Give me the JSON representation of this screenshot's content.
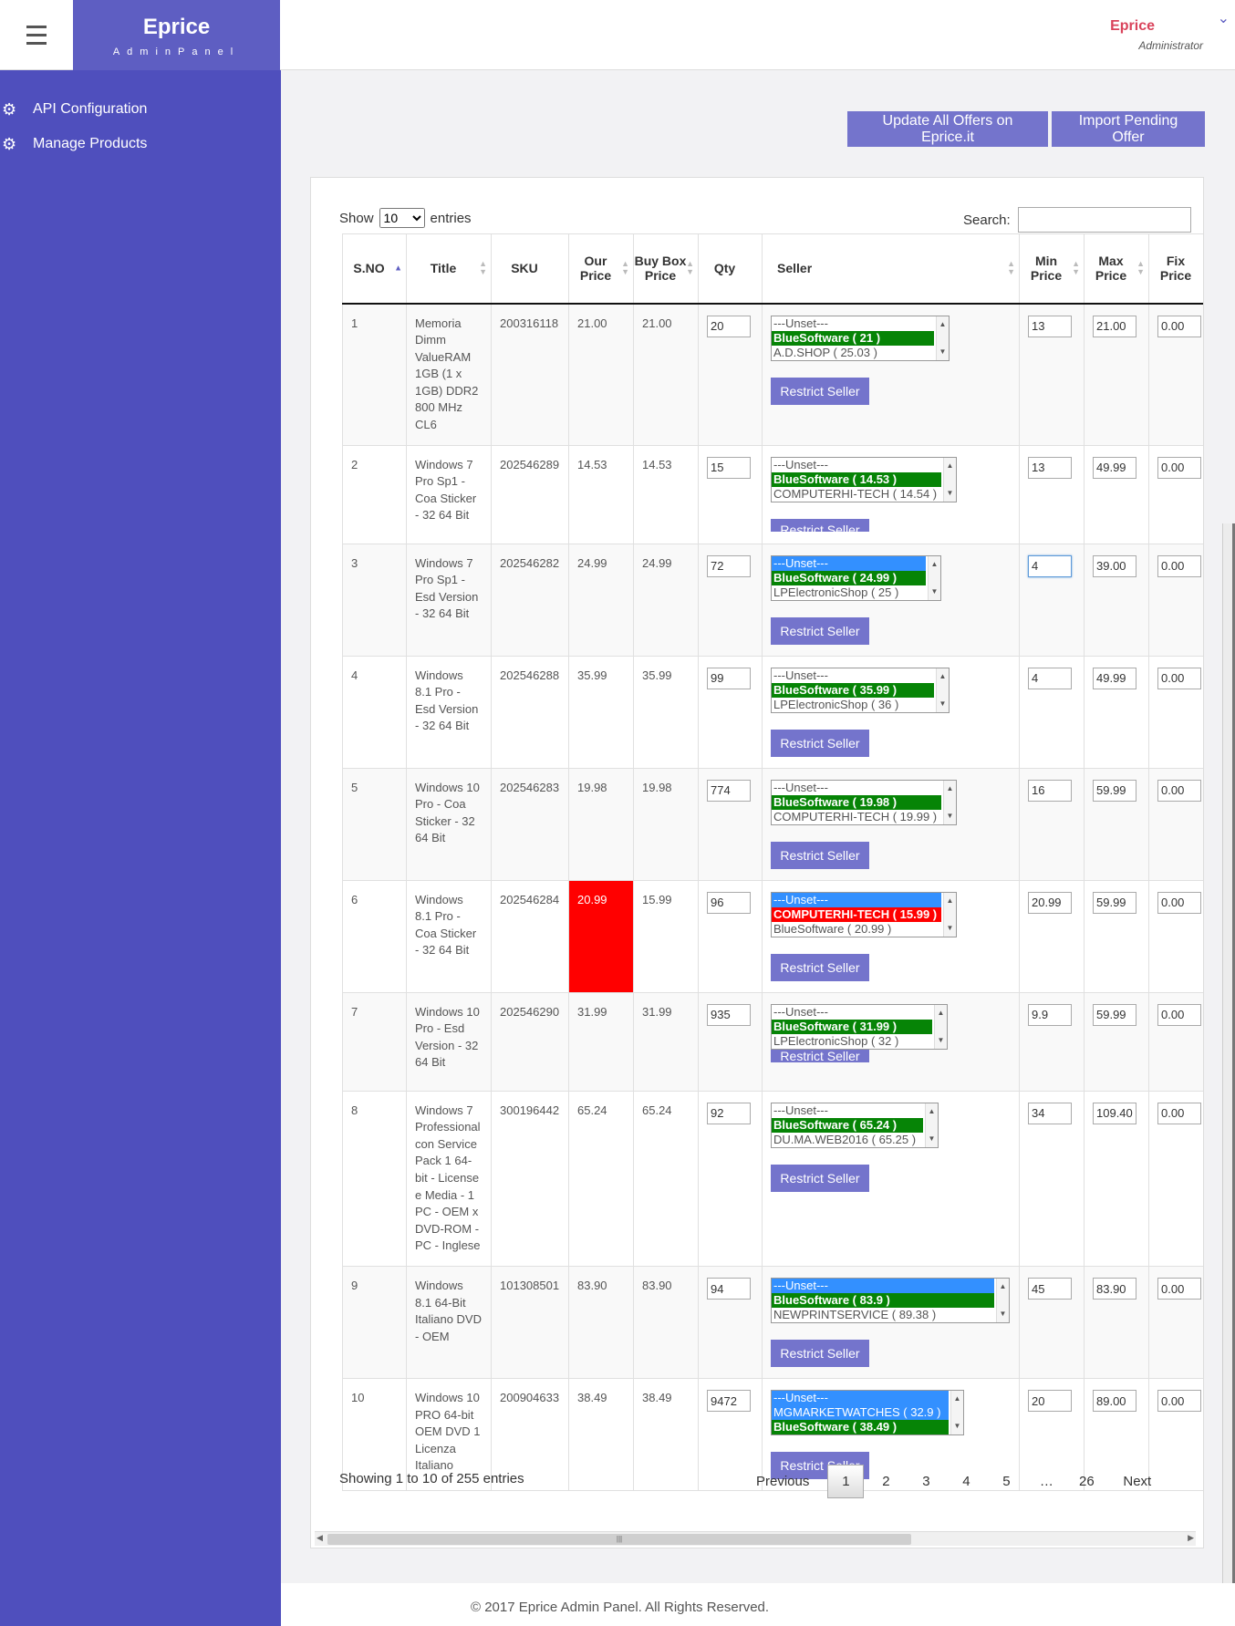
{
  "header": {
    "brand_title": "Eprice",
    "brand_subtitle": "AdminPanel",
    "user_name": "Eprice",
    "user_role": "Administrator"
  },
  "sidebar": {
    "items": [
      {
        "label": "API Configuration",
        "icon": "gears-icon"
      },
      {
        "label": "Manage Products",
        "icon": "gears-icon"
      }
    ]
  },
  "actions": {
    "update_all": "Update All Offers on Eprice.it",
    "import_pending": "Import Pending Offer"
  },
  "table_controls": {
    "show_label": "Show",
    "entries_value": "10",
    "entries_label": "entries",
    "search_label": "Search:"
  },
  "columns": [
    "S.NO",
    "Title",
    "SKU",
    "Our Price",
    "Buy Box Price",
    "Qty",
    "Seller",
    "Min Price",
    "Max Price",
    "Fix Price"
  ],
  "restrict_label": "Restrict Seller",
  "rows": [
    {
      "sno": "1",
      "title": "Memoria Dimm ValueRAM 1GB (1 x 1GB) DDR2 800 MHz CL6",
      "sku": "200316118",
      "our_price": "21.00",
      "buybox": "21.00",
      "qty": "20",
      "sellers": [
        "---Unset---",
        "BlueSoftware ( 21 )",
        "A.D.SHOP ( 25.03 )"
      ],
      "min": "13",
      "max": "21.00",
      "fix": "0.00"
    },
    {
      "sno": "2",
      "title": "Windows 7 Pro Sp1 - Coa Sticker - 32 64 Bit",
      "sku": "202546289",
      "our_price": "14.53",
      "buybox": "14.53",
      "qty": "15",
      "sellers": [
        "---Unset---",
        "BlueSoftware ( 14.53 )",
        "COMPUTERHI-TECH ( 14.54 )"
      ],
      "min": "13",
      "max": "49.99",
      "fix": "0.00"
    },
    {
      "sno": "3",
      "title": "Windows 7 Pro Sp1 - Esd Version - 32 64 Bit",
      "sku": "202546282",
      "our_price": "24.99",
      "buybox": "24.99",
      "qty": "72",
      "sellers": [
        "---Unset---",
        "BlueSoftware ( 24.99 )",
        "LPElectronicShop ( 25 )"
      ],
      "min": "4",
      "max": "39.00",
      "fix": "0.00"
    },
    {
      "sno": "4",
      "title": "Windows 8.1 Pro - Esd Version - 32 64 Bit",
      "sku": "202546288",
      "our_price": "35.99",
      "buybox": "35.99",
      "qty": "99",
      "sellers": [
        "---Unset---",
        "BlueSoftware ( 35.99 )",
        "LPElectronicShop ( 36 )"
      ],
      "min": "4",
      "max": "49.99",
      "fix": "0.00"
    },
    {
      "sno": "5",
      "title": "Windows 10 Pro - Coa Sticker - 32 64 Bit",
      "sku": "202546283",
      "our_price": "19.98",
      "buybox": "19.98",
      "qty": "774",
      "sellers": [
        "---Unset---",
        "BlueSoftware ( 19.98 )",
        "COMPUTERHI-TECH ( 19.99 )"
      ],
      "min": "16",
      "max": "59.99",
      "fix": "0.00"
    },
    {
      "sno": "6",
      "title": "Windows 8.1 Pro - Coa Sticker - 32 64 Bit",
      "sku": "202546284",
      "our_price": "20.99",
      "buybox": "15.99",
      "qty": "96",
      "sellers": [
        "---Unset---",
        "COMPUTERHI-TECH ( 15.99 )",
        "BlueSoftware ( 20.99 )"
      ],
      "min": "20.99",
      "max": "59.99",
      "fix": "0.00"
    },
    {
      "sno": "7",
      "title": "Windows 10 Pro - Esd Version - 32 64 Bit",
      "sku": "202546290",
      "our_price": "31.99",
      "buybox": "31.99",
      "qty": "935",
      "sellers": [
        "---Unset---",
        "BlueSoftware ( 31.99 )",
        "LPElectronicShop ( 32 )"
      ],
      "min": "9.9",
      "max": "59.99",
      "fix": "0.00"
    },
    {
      "sno": "8",
      "title": "Windows 7 Professional con Service Pack 1 64-bit - License e Media - 1 PC - OEM x DVD-ROM - PC - Inglese",
      "sku": "300196442",
      "our_price": "65.24",
      "buybox": "65.24",
      "qty": "92",
      "sellers": [
        "---Unset---",
        "BlueSoftware ( 65.24 )",
        "DU.MA.WEB2016 ( 65.25 )"
      ],
      "min": "34",
      "max": "109.40",
      "fix": "0.00"
    },
    {
      "sno": "9",
      "title": "Windows 8.1 64-Bit Italiano DVD - OEM",
      "sku": "101308501",
      "our_price": "83.90",
      "buybox": "83.90",
      "qty": "94",
      "sellers": [
        "---Unset---",
        "BlueSoftware ( 83.9 )",
        "NEWPRINTSERVICE ( 89.38 )"
      ],
      "min": "45",
      "max": "83.90",
      "fix": "0.00"
    },
    {
      "sno": "10",
      "title": "Windows 10 PRO 64-bit OEM DVD 1 Licenza Italiano",
      "sku": "200904633",
      "our_price": "38.49",
      "buybox": "38.49",
      "qty": "9472",
      "sellers": [
        "---Unset---",
        "MGMARKETWATCHES ( 32.9 )",
        "BlueSoftware ( 38.49 )"
      ],
      "min": "20",
      "max": "89.00",
      "fix": "0.00"
    }
  ],
  "footer_table": {
    "info": "Showing 1 to 10 of 255 entries",
    "previous": "Previous",
    "pages": [
      "1",
      "2",
      "3",
      "4",
      "5",
      "…",
      "26"
    ],
    "next": "Next"
  },
  "footer": "© 2017 Eprice Admin Panel. All Rights Reserved.",
  "colors": {
    "sidebar": "#4f4fbd",
    "brand": "#5e5ec2",
    "button": "#7474cc",
    "winner_green": "#068406",
    "alert_red": "#ff0000",
    "selected_blue": "#3390ff"
  }
}
